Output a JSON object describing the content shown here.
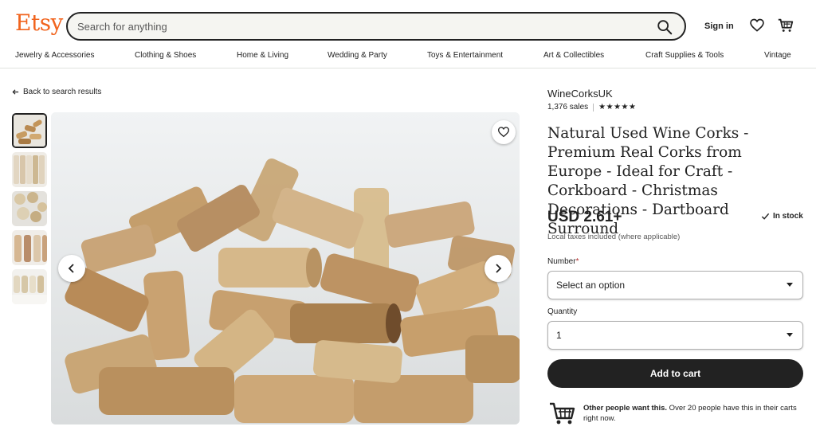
{
  "header": {
    "logo": "Etsy",
    "search_placeholder": "Search for anything",
    "signin": "Sign in"
  },
  "nav": [
    "Jewelry & Accessories",
    "Clothing & Shoes",
    "Home & Living",
    "Wedding & Party",
    "Toys & Entertainment",
    "Art & Collectibles",
    "Craft Supplies & Tools",
    "Vintage"
  ],
  "back_link": "Back to search results",
  "shop": {
    "name": "WineCorksUK",
    "sales": "1,376 sales",
    "rating": "★★★★★"
  },
  "product": {
    "title": "Natural Used Wine Corks - Premium Real Corks from Europe - Ideal for Craft - Corkboard - Christmas Decorations - Dartboard Surround",
    "price": "USD 2.61+",
    "stock": "In stock",
    "taxes": "Local taxes included (where applicable)"
  },
  "options": {
    "number_label": "Number",
    "required_mark": "*",
    "number_value": "Select an option",
    "quantity_label": "Quantity",
    "quantity_value": "1"
  },
  "add_to_cart": "Add to cart",
  "demand": {
    "bold": "Other people want this.",
    "rest": " Over 20 people have this in their carts right now."
  },
  "colors": {
    "brand": "#f1641e",
    "button": "#222222"
  }
}
